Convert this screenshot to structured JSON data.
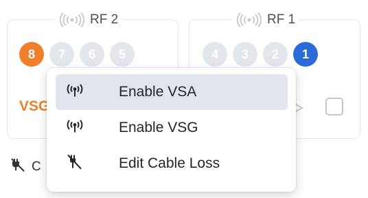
{
  "rf2": {
    "title": "RF 2",
    "ports": [
      "8",
      "7",
      "6",
      "5"
    ],
    "mode": "VSG"
  },
  "rf1": {
    "title": "RF 1",
    "ports": [
      "4",
      "3",
      "2",
      "1"
    ]
  },
  "bottom": {
    "text": "C"
  },
  "menu": {
    "items": [
      {
        "label": "Enable VSA",
        "icon": "antenna-broadcast-icon"
      },
      {
        "label": "Enable VSG",
        "icon": "antenna-broadcast-icon"
      },
      {
        "label": "Edit Cable Loss",
        "icon": "cable-plug-icon"
      }
    ]
  },
  "colors": {
    "orange": "#ef7f2a",
    "blue": "#2a6bd8",
    "inactive_port": "#e3e6ec",
    "selected_bg": "#e3e5ee"
  }
}
